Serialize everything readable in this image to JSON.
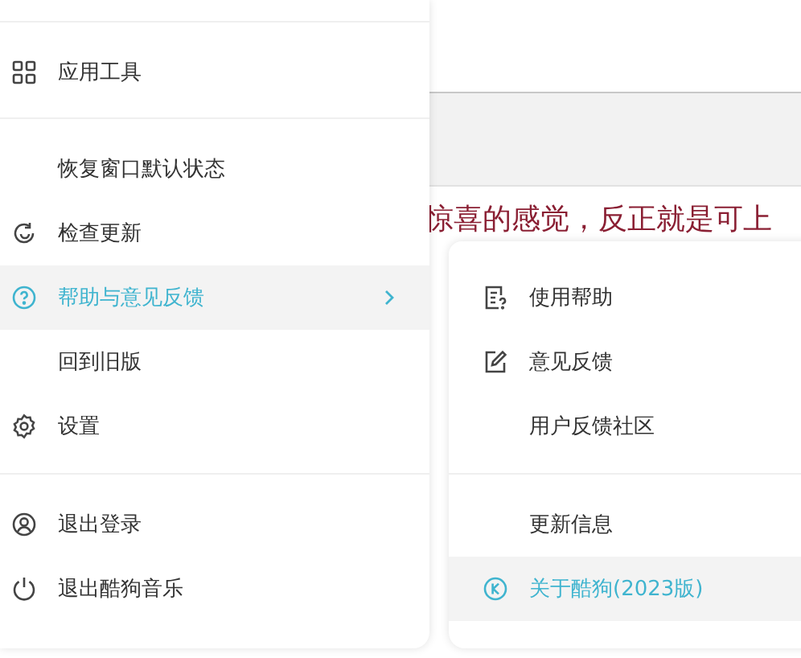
{
  "background": {
    "text": "惊喜的感觉，反正就是可上"
  },
  "main_menu": {
    "sections": [
      [
        {
          "label": "应用工具",
          "selected": false,
          "submenu": false
        }
      ],
      [
        {
          "label": "恢复窗口默认状态",
          "selected": false,
          "submenu": false
        },
        {
          "label": "检查更新",
          "selected": false,
          "submenu": false
        },
        {
          "label": "帮助与意见反馈",
          "selected": true,
          "submenu": true
        },
        {
          "label": "回到旧版",
          "selected": false,
          "submenu": false
        },
        {
          "label": "设置",
          "selected": false,
          "submenu": false
        }
      ],
      [
        {
          "label": "退出登录",
          "selected": false,
          "submenu": false
        },
        {
          "label": "退出酷狗音乐",
          "selected": false,
          "submenu": false
        }
      ]
    ]
  },
  "help_menu": {
    "sections": [
      [
        {
          "label": "使用帮助",
          "selected": false
        },
        {
          "label": "意见反馈",
          "selected": false
        },
        {
          "label": "用户反馈社区",
          "selected": false
        }
      ],
      [
        {
          "label": "更新信息",
          "selected": false
        },
        {
          "label": "关于酷狗(2023版)",
          "selected": true
        }
      ]
    ]
  }
}
